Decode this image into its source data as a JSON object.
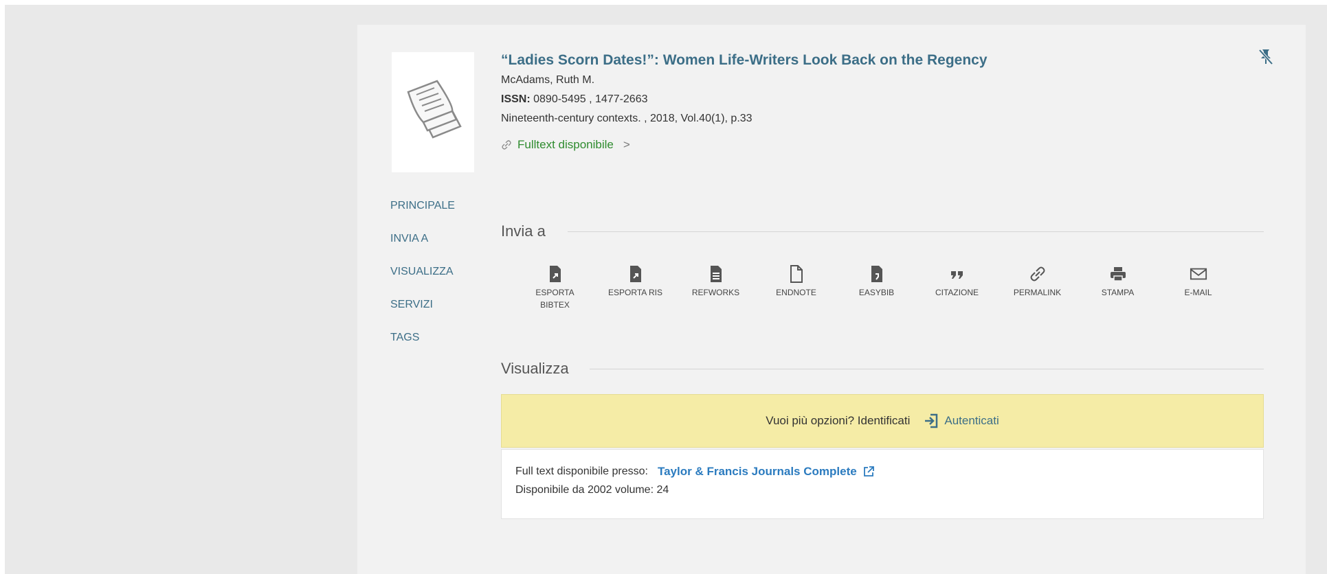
{
  "record": {
    "title": "“Ladies Scorn Dates!”: Women Life-Writers Look Back on the Regency",
    "author": "McAdams, Ruth M.",
    "issn_label": "ISSN:",
    "issn_value": "0890-5495 , 1477-2663",
    "source": "Nineteenth-century contexts. , 2018, Vol.40(1), p.33",
    "fulltext_link": "Fulltext disponibile",
    "fulltext_chevron": ">"
  },
  "nav": {
    "items": [
      {
        "label": "PRINCIPALE"
      },
      {
        "label": "INVIA A"
      },
      {
        "label": "VISUALIZZA"
      },
      {
        "label": "SERVIZI"
      },
      {
        "label": "TAGS"
      }
    ]
  },
  "send_to": {
    "title": "Invia a",
    "actions": [
      {
        "label": "ESPORTA BIBTEX",
        "icon": "file-export-icon"
      },
      {
        "label": "ESPORTA RIS",
        "icon": "file-export-icon"
      },
      {
        "label": "REFWORKS",
        "icon": "document-lines-icon"
      },
      {
        "label": "ENDNOTE",
        "icon": "document-outline-icon"
      },
      {
        "label": "EASYBIB",
        "icon": "easybib-icon"
      },
      {
        "label": "CITAZIONE",
        "icon": "quote-icon"
      },
      {
        "label": "PERMALINK",
        "icon": "link-icon"
      },
      {
        "label": "STAMPA",
        "icon": "printer-icon"
      },
      {
        "label": "E-MAIL",
        "icon": "envelope-icon"
      }
    ]
  },
  "view": {
    "title": "Visualizza",
    "login_prompt": "Vuoi più opzioni? Identificati",
    "login_link": "Autenticati",
    "available_at_label": "Full text disponibile presso:",
    "provider": "Taylor & Francis Journals Complete",
    "coverage": "Disponibile da 2002 volume: 24"
  },
  "colors": {
    "accent": "#3c6e87",
    "link": "#2b7bbf",
    "fulltext_green": "#2e8b2e",
    "login_bar": "#f5eca6"
  }
}
